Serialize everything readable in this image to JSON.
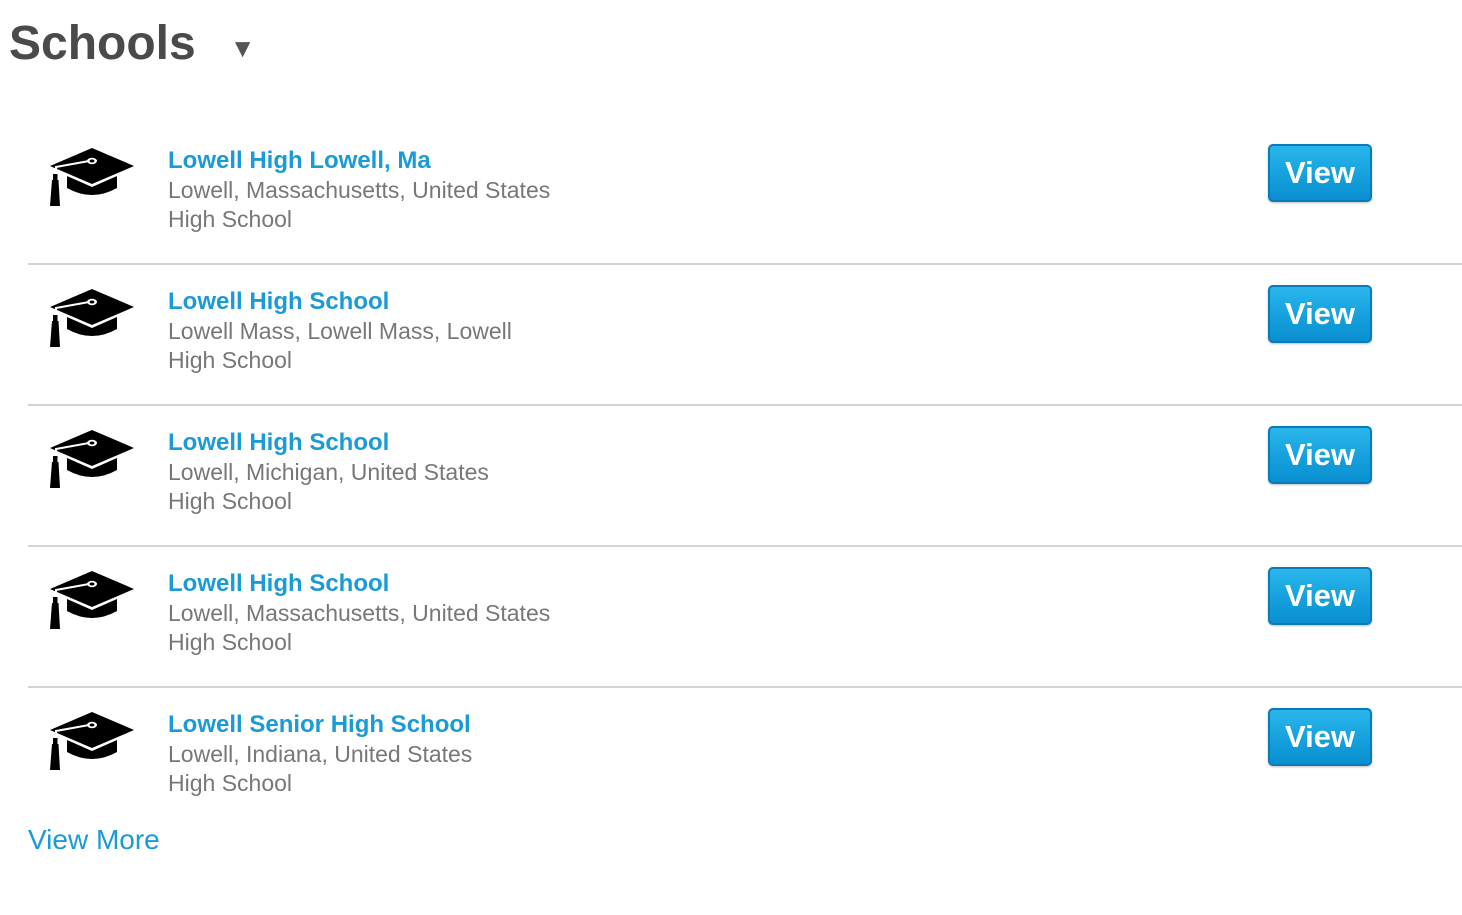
{
  "header": {
    "title": "Schools",
    "dropdown_glyph": "▼"
  },
  "schools": [
    {
      "name": "Lowell High Lowell, Ma",
      "location": "Lowell, Massachusetts, United States",
      "type": "High School",
      "button_label": "View",
      "icon": "graduation-cap-icon"
    },
    {
      "name": "Lowell High School",
      "location": "Lowell Mass, Lowell Mass, Lowell",
      "type": "High School",
      "button_label": "View",
      "icon": "graduation-cap-icon"
    },
    {
      "name": "Lowell High School",
      "location": "Lowell, Michigan, United States",
      "type": "High School",
      "button_label": "View",
      "icon": "graduation-cap-icon"
    },
    {
      "name": "Lowell High School",
      "location": "Lowell, Massachusetts, United States",
      "type": "High School",
      "button_label": "View",
      "icon": "graduation-cap-icon"
    },
    {
      "name": "Lowell Senior High School",
      "location": "Lowell, Indiana, United States",
      "type": "High School",
      "button_label": "View",
      "icon": "graduation-cap-icon"
    }
  ],
  "view_more_label": "View More",
  "colors": {
    "link": "#1a9ad6",
    "title": "#4a4a4a",
    "secondary_text": "#777777",
    "button": "#16a2de",
    "divider": "#d3d3d3"
  }
}
